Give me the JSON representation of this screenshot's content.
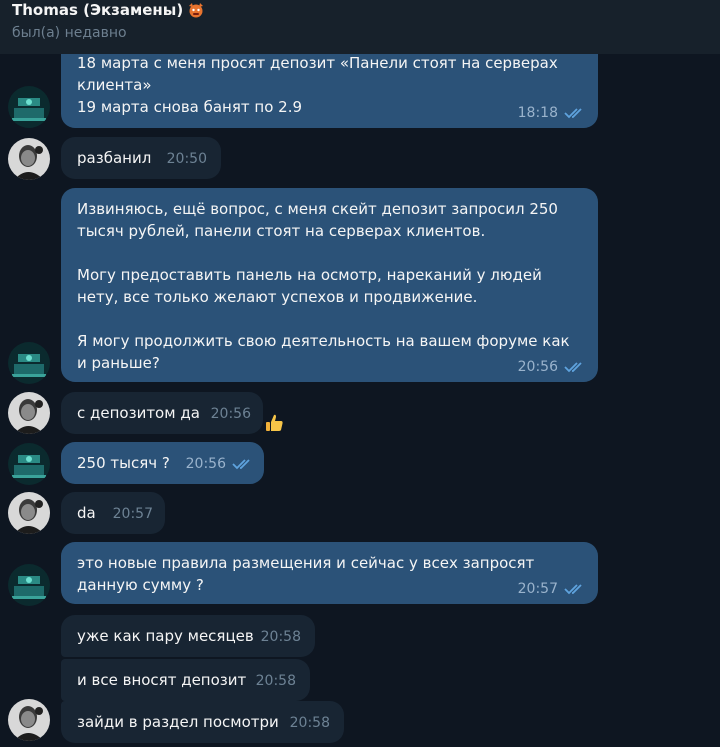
{
  "header": {
    "title": "Thomas (Экзамены)",
    "status": "был(а) недавно"
  },
  "messages": [
    {
      "dir": "out",
      "text": "18 марта с меня просят депозит «Панели стоят на серверах клиента»\n19 марта снова банят по 2.9",
      "time": "18:18",
      "read": true
    },
    {
      "dir": "in",
      "text": "разбанил",
      "time": "20:50"
    },
    {
      "dir": "out",
      "text": "Извиняюсь, ещё вопрос, с меня скейт депозит запросил 250 тысяч рублей, панели стоят на серверах клиентов.\n\nМогу предоставить панель на осмотр, нареканий у людей нету, все только желают успехов и продвижение.\n\nЯ могу продолжить свою деятельность на вашем форуме как и раньше?",
      "time": "20:56",
      "read": true
    },
    {
      "dir": "in",
      "text": "с депозитом да",
      "time": "20:56",
      "reaction": "thumbs-up"
    },
    {
      "dir": "out",
      "text": "250 тысяч ?",
      "time": "20:56",
      "read": true
    },
    {
      "dir": "in",
      "text": "da",
      "time": "20:57"
    },
    {
      "dir": "out",
      "text": "это новые правила размещения и сейчас у всех запросят данную сумму ?",
      "time": "20:57",
      "read": true
    },
    {
      "dir": "in",
      "text": "уже как пару месяцев",
      "time": "20:58"
    },
    {
      "dir": "in",
      "text": "и все вносят депозит",
      "time": "20:58"
    },
    {
      "dir": "in",
      "text": "зайди в раздел посмотри",
      "time": "20:58"
    }
  ],
  "colors": {
    "background": "#0e1621",
    "header": "#17212b",
    "outgoing_bubble": "#2b5278",
    "incoming_bubble": "#182533",
    "read_check": "#5fa3de"
  }
}
